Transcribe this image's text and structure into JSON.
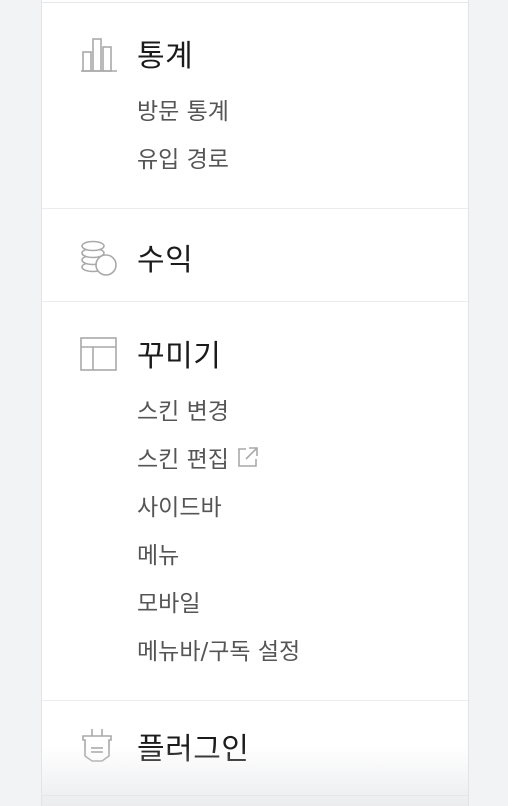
{
  "colors": {
    "background": "#f2f3f5",
    "panel": "#ffffff",
    "title": "#1b1b1b",
    "subitem": "#555555",
    "icon": "#a9a9a9"
  },
  "sections": [
    {
      "icon": "bar-chart-icon",
      "title": "통계",
      "items": [
        {
          "label": "방문 통계"
        },
        {
          "label": "유입 경로"
        }
      ]
    },
    {
      "icon": "coins-icon",
      "title": "수익",
      "items": []
    },
    {
      "icon": "layout-icon",
      "title": "꾸미기",
      "items": [
        {
          "label": "스킨 변경"
        },
        {
          "label": "스킨 편집",
          "external": true,
          "trailing_icon": "external-link-icon"
        },
        {
          "label": "사이드바"
        },
        {
          "label": "메뉴"
        },
        {
          "label": "모바일"
        },
        {
          "label": "메뉴바/구독 설정"
        }
      ]
    },
    {
      "icon": "plug-icon",
      "title": "플러그인",
      "items": []
    }
  ]
}
